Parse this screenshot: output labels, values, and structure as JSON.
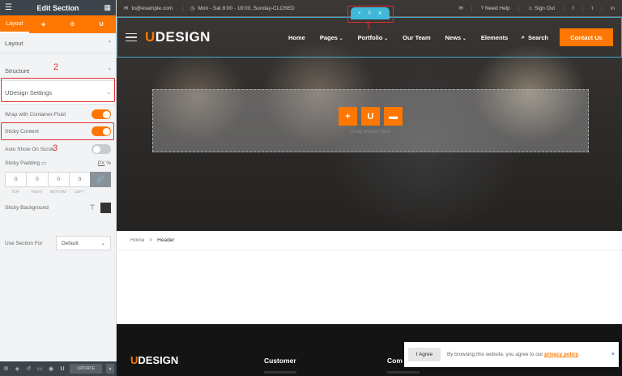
{
  "sidebar": {
    "title": "Edit Section",
    "tabs": [
      {
        "label": "Layout",
        "icon": "layout-icon"
      },
      {
        "label": "",
        "icon": "layers-icon"
      },
      {
        "label": "",
        "icon": "gear-icon"
      },
      {
        "label": "",
        "icon": "udesign-icon"
      }
    ],
    "sections": {
      "layout": "Layout",
      "structure": "Structure",
      "udesign_settings": "UDesign Settings"
    },
    "controls": {
      "wrap_container_fluid": {
        "label": "Wrap with Container-Fluid",
        "on": true
      },
      "sticky_content": {
        "label": "Sticky Content",
        "on": true
      },
      "auto_show_on_scroll": {
        "label": "Auto Show On Scroll",
        "on": false
      },
      "sticky_padding": {
        "label": "Sticky Padding",
        "unit": "PX",
        "unit_suffix": "%",
        "values": [
          "0",
          "0",
          "0",
          "0"
        ],
        "sides": [
          "TOP",
          "RIGHT",
          "BOTTOM",
          "LEFT"
        ]
      },
      "sticky_background": {
        "label": "Sticky Background"
      },
      "use_section_for": {
        "label": "Use Section For",
        "value": "Default"
      }
    },
    "footer": {
      "update_label": "UPDATE"
    }
  },
  "annotations": {
    "n1": "1",
    "n2": "2",
    "n3": "3"
  },
  "preview": {
    "topbar": {
      "email": "to@example.com",
      "hours": "Mon - Sat 8:00 - 18:00, Sunday-CLOSED",
      "need_help": "Need Help",
      "sign_out": "Sign Out",
      "social": [
        "f",
        "t",
        "in"
      ]
    },
    "header": {
      "logo_u": "U",
      "logo_rest": "DESIGN",
      "menu": [
        "Home",
        "Pages",
        "Portfolio",
        "Our Team",
        "News",
        "Elements"
      ],
      "search": "Search",
      "contact": "Contact Us"
    },
    "dropzone": {
      "text": "Drag widget here"
    },
    "breadcrumb": {
      "home": "Home",
      "separator": ">",
      "current": "Header"
    },
    "footer": {
      "logo_u": "U",
      "logo_rest": "DESIGN",
      "col1": "Customer",
      "col2": "Com"
    },
    "cookie": {
      "agree": "I Agree",
      "text": "By browsing this website, you agree to our ",
      "link": "privacy policy",
      "suffix": ".",
      "close": "×"
    }
  },
  "colors": {
    "accent": "#ff7700",
    "annotation": "#e03030",
    "selection": "#3fb8d9",
    "sidebar_dark": "#3e444b"
  }
}
